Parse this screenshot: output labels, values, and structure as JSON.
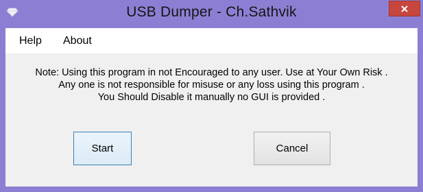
{
  "window": {
    "title": "USB Dumper - Ch.Sathvik",
    "app_icon": "diamond-icon",
    "close_icon": "close-icon",
    "colors": {
      "frame": "#8c7fd3",
      "close_button": "#c7463e",
      "client_background": "#f0f0f0",
      "default_button_border": "#3c7fb1"
    }
  },
  "menu": {
    "items": [
      {
        "label": "Help"
      },
      {
        "label": "About"
      }
    ]
  },
  "note": {
    "lines": [
      "Note: Using this program in not Encouraged to any user. Use at Your Own Risk .",
      "Any one is not responsible for misuse or any loss using this program .",
      "You Should Disable it manually no GUI is provided ."
    ]
  },
  "buttons": {
    "start_label": "Start",
    "cancel_label": "Cancel"
  }
}
